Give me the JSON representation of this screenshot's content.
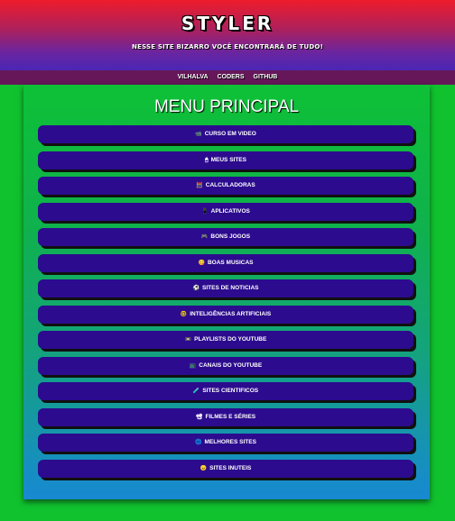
{
  "header": {
    "brand": "STYLER",
    "tagline": "NESSE SITE BIZARRO VOCÊ ENCONTRARÁ DE TUDO!"
  },
  "nav": {
    "links": [
      "VILHALVA",
      "CODERS",
      "GITHUB"
    ]
  },
  "menu": {
    "title": "MENU PRINCIPAL",
    "items": [
      {
        "icon": "📹",
        "label": "CURSO EM VIDEO"
      },
      {
        "icon": "🖱",
        "label": "MEUS SITES"
      },
      {
        "icon": "🧮",
        "label": "CALCULADORAS"
      },
      {
        "icon": "📱",
        "label": "APLICATIVOS"
      },
      {
        "icon": "🎮",
        "label": "BONS JOGOS"
      },
      {
        "icon": "😋",
        "label": "BOAS MUSICAS"
      },
      {
        "icon": "⚽",
        "label": "SITES DE NOTICIAS"
      },
      {
        "icon": "🤓",
        "label": "INTELIGÊNCIAS ARTIFICIAIS"
      },
      {
        "icon": "📼",
        "label": "PLAYLISTS DO YOUTUBE"
      },
      {
        "icon": "📺",
        "label": "CANAIS DO YOUTUBE"
      },
      {
        "icon": "🧪",
        "label": "SITES CIENTIFICOS"
      },
      {
        "icon": "📽",
        "label": "FILMES E SÉRIES"
      },
      {
        "icon": "🌐",
        "label": "MELHORES SITES"
      },
      {
        "icon": "😠",
        "label": "SITES INUTEIS"
      }
    ]
  }
}
